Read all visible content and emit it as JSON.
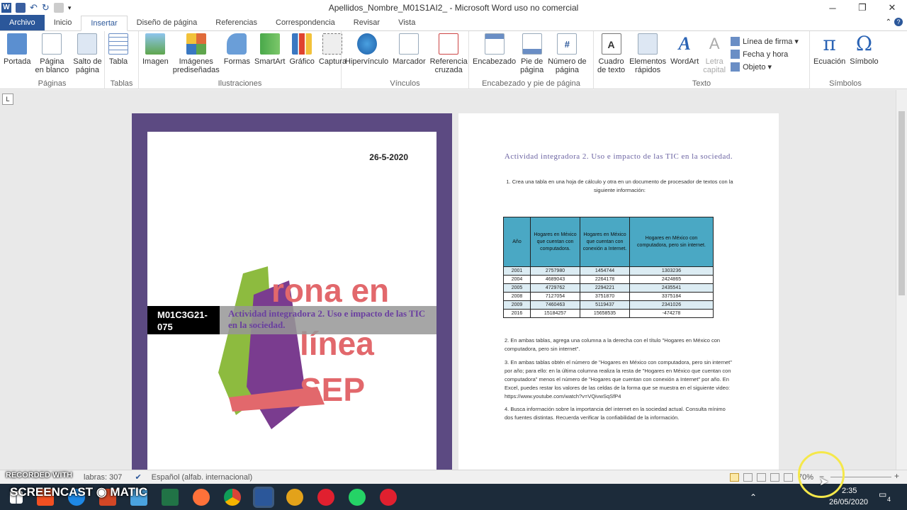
{
  "window": {
    "title": "Apellidos_Nombre_M01S1AI2_ - Microsoft Word uso no comercial",
    "controls": [
      "─",
      "❐",
      "✕"
    ]
  },
  "tabs": [
    "Archivo",
    "Inicio",
    "Insertar",
    "Diseño de página",
    "Referencias",
    "Correspondencia",
    "Revisar",
    "Vista"
  ],
  "active_tab": "Insertar",
  "ribbon": {
    "groups": [
      {
        "label": "Páginas",
        "buttons": [
          "Portada",
          "Página\nen blanco",
          "Salto de\npágina"
        ]
      },
      {
        "label": "Tablas",
        "buttons": [
          "Tabla"
        ]
      },
      {
        "label": "Ilustraciones",
        "buttons": [
          "Imagen",
          "Imágenes\nprediseñadas",
          "Formas",
          "SmartArt",
          "Gráfico",
          "Captura"
        ]
      },
      {
        "label": "Vínculos",
        "buttons": [
          "Hipervínculo",
          "Marcador",
          "Referencia\ncruzada"
        ]
      },
      {
        "label": "Encabezado y pie de página",
        "buttons": [
          "Encabezado",
          "Pie de\npágina",
          "Número de\npágina"
        ]
      },
      {
        "label": "Texto",
        "buttons": [
          "Cuadro\nde texto",
          "Elementos\nrápidos",
          "WordArt",
          "Letra\ncapital"
        ],
        "small": [
          "Línea de firma ▾",
          "Fecha y hora",
          "Objeto ▾"
        ]
      },
      {
        "label": "Símbolos",
        "buttons": [
          "Ecuación",
          "Símbolo"
        ]
      }
    ]
  },
  "page1": {
    "date": "26-5-2020",
    "code": "M01C3G21-075",
    "title": "Actividad integradora 2. Uso e impacto de las TIC en la sociedad."
  },
  "page2": {
    "title": "Actividad integradora 2. Uso e impacto de las TIC en la sociedad.",
    "item1": "1. Crea una tabla en una hoja de cálculo y otra en un documento de procesador de textos con la siguiente información:",
    "table_headers": [
      "Año",
      "Hogares en México que cuentan con computadora.",
      "Hogares en México que cuentan con conexión a Internet.",
      "Hogares en México con computadora, pero sin internet."
    ],
    "table_rows": [
      [
        "2001",
        "2757980",
        "1454744",
        "1303236"
      ],
      [
        "2004",
        "4689043",
        "2264178",
        "2424865"
      ],
      [
        "2005",
        "4729762",
        "2294221",
        "2435541"
      ],
      [
        "2008",
        "7127054",
        "3751870",
        "3375184"
      ],
      [
        "2009",
        "7460463",
        "5119437",
        "2341026"
      ],
      [
        "2016",
        "15184257",
        "15658535",
        "-474278"
      ]
    ],
    "item2": "2. En ambas tablas, agrega una columna a la derecha con el título \"Hogares en México con computadora, pero sin internet\".",
    "item3": "3. En ambas tablas obtén el número de \"Hogares en México con computadora, pero sin internet\" por año; para ello: en la última columna realiza la resta de \"Hogares en México que cuentan con computadora\" menos el número de \"Hogares que cuentan con conexión a Internet\" por año. En Excel, puedes restar los valores de las celdas de la forma que se muestra en el siguiente video: https://www.youtube.com/watch?v=VQivwSqSfP4",
    "item4": "4. Busca información sobre la importancia del internet en la sociedad actual. Consulta mínimo dos fuentes distintas. Recuerda verificar la confiabilidad de la información."
  },
  "status": {
    "words": "labras: 307",
    "language": "Español (alfab. internacional)",
    "zoom": "70%"
  },
  "taskbar": {
    "time": "2:35",
    "date": "26/05/2020",
    "notifications": "4"
  },
  "watermark": {
    "line1": "RECORDED WITH",
    "line2": "SCREENCAST ◉ MATIC"
  },
  "colors": {
    "word_blue": "#2b579a",
    "cover_purple": "#5c4a82",
    "table_header": "#4aa8c4",
    "taskbar": "#1c2b3a"
  }
}
